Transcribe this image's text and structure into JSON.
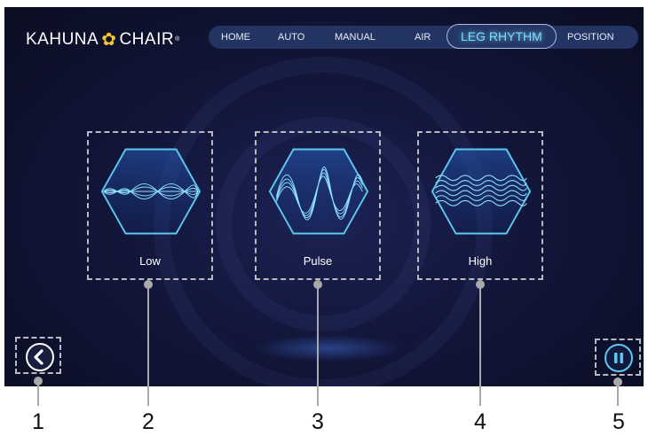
{
  "app": {
    "logo_left": "KAHUNA",
    "logo_right": "CHAIR",
    "logo_mark": "®",
    "logo_icon": "plumeria-flower-icon"
  },
  "nav": {
    "tabs": [
      {
        "label": "HOME",
        "active": false
      },
      {
        "label": "AUTO",
        "active": false
      },
      {
        "label": "MANUAL",
        "active": false
      },
      {
        "label": "AIR",
        "active": false
      },
      {
        "label": "LEG RHYTHM",
        "active": true
      },
      {
        "label": "POSITION",
        "active": false
      }
    ]
  },
  "modes": [
    {
      "label": "Low",
      "icon": "low-wave-icon"
    },
    {
      "label": "Pulse",
      "icon": "pulse-wave-icon"
    },
    {
      "label": "High",
      "icon": "high-wave-icon"
    }
  ],
  "controls": {
    "back_icon": "chevron-left-icon",
    "pause_icon": "pause-icon"
  },
  "callouts": [
    "1",
    "2",
    "3",
    "4",
    "5"
  ],
  "colors": {
    "accent": "#7fdcff",
    "background": "#12163a",
    "nav_bar": "#233463",
    "wave": "#5ec8f0",
    "logo_flower": "#f3c632"
  }
}
